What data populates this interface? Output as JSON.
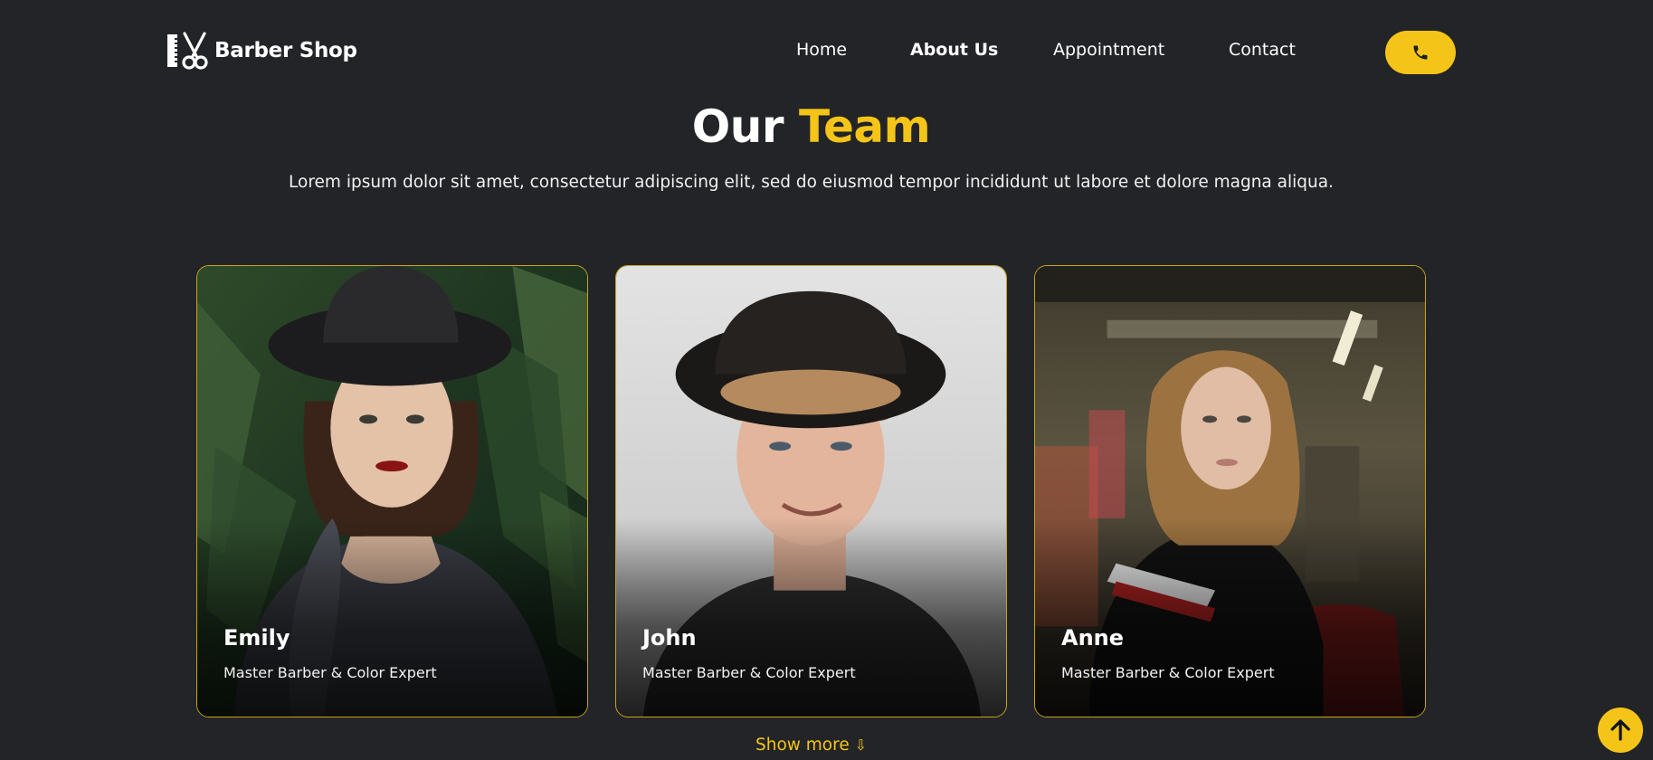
{
  "brand": {
    "name": "Barber Shop",
    "logo_icon": "comb-scissors-icon"
  },
  "nav": {
    "items": [
      {
        "label": "Home",
        "active": false
      },
      {
        "label": "About Us",
        "active": true
      },
      {
        "label": "Appointment",
        "active": false
      },
      {
        "label": "Contact",
        "active": false
      }
    ],
    "phone_icon": "phone-icon"
  },
  "team": {
    "title_plain": "Our",
    "title_accent": "Team",
    "subtitle": "Lorem ipsum dolor sit amet, consectetur adipiscing elit, sed do eiusmod tempor incididunt ut labore et dolore magna aliqua.",
    "members": [
      {
        "name": "Emily",
        "role": "Master Barber & Color Expert"
      },
      {
        "name": "John",
        "role": "Master Barber & Color Expert"
      },
      {
        "name": "Anne",
        "role": "Master Barber & Color Expert"
      }
    ],
    "show_more_label": "Show more",
    "show_more_arrow": "⇩"
  },
  "back_to_top_icon": "arrow-up-icon",
  "colors": {
    "background": "#232427",
    "accent": "#f4c518",
    "text": "#ffffff"
  }
}
